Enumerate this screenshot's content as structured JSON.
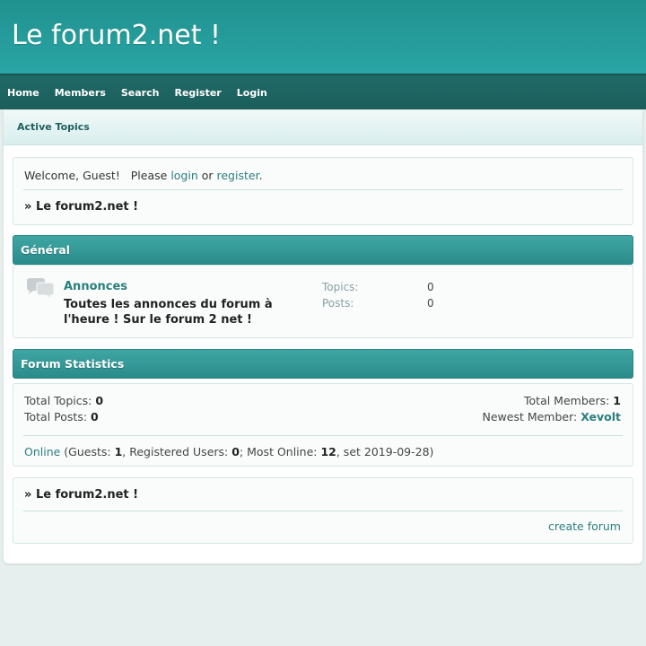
{
  "site": {
    "title": "Le forum2.net !"
  },
  "nav": [
    {
      "label": "Home"
    },
    {
      "label": "Members"
    },
    {
      "label": "Search"
    },
    {
      "label": "Register"
    },
    {
      "label": "Login"
    }
  ],
  "subnav": {
    "active_topics": "Active Topics"
  },
  "welcome": {
    "prefix": "Welcome, Guest!   Please ",
    "login": "login",
    "or": " or ",
    "register": "register",
    "suffix": "."
  },
  "breadcrumb": {
    "arrow": "» ",
    "label": "Le forum2.net !"
  },
  "category": {
    "name": "Général"
  },
  "forum": {
    "icon": "chat-bubbles-icon",
    "name": "Annonces",
    "description": "Toutes les annonces du forum à l'heure ! Sur le forum 2 net !",
    "topics_label": "Topics:",
    "topics_value": "0",
    "posts_label": "Posts:",
    "posts_value": "0"
  },
  "statistics": {
    "title": "Forum Statistics",
    "total_topics_label": "Total Topics: ",
    "total_topics": "0",
    "total_posts_label": "Total Posts: ",
    "total_posts": "0",
    "total_members_label": "Total Members: ",
    "total_members": "1",
    "newest_member_label": "Newest Member: ",
    "newest_member": "Xevolt",
    "online_link": "Online",
    "guests_label": " (Guests: ",
    "guests": "1",
    "registered_label": ", Registered Users: ",
    "registered": "0",
    "most_online_label": "; Most Online: ",
    "most_online": "12",
    "most_online_date": ", set 2019-09-28)"
  },
  "footer": {
    "create_forum": "create forum"
  },
  "colors": {
    "header": "#2aa5a5",
    "navbar": "#1b5e5c",
    "accent": "#2a7f7b",
    "category_header": "#3fa6a4",
    "background": "#e6efee"
  }
}
